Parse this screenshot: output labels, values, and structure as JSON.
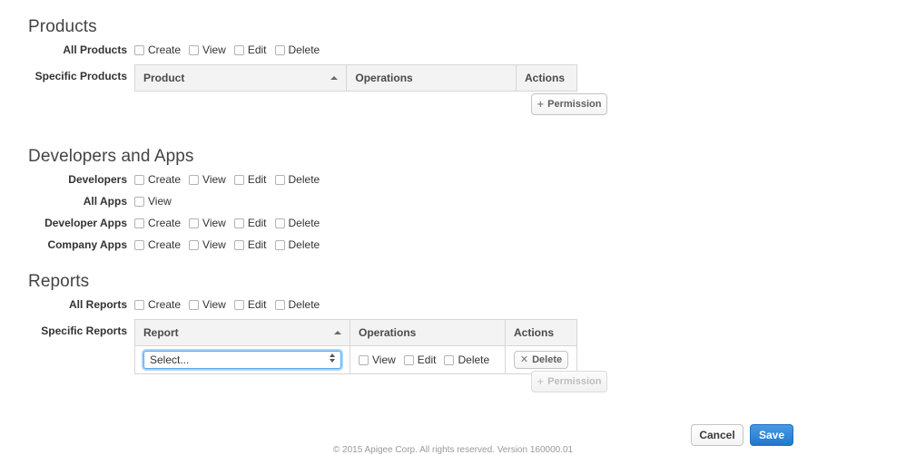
{
  "sections": [
    {
      "id": "products",
      "title": "Products",
      "rows": [
        {
          "label": "All Products",
          "type": "checkboxes",
          "checkboxes": [
            {
              "label": "Create",
              "checked": false
            },
            {
              "label": "View",
              "checked": false
            },
            {
              "label": "Edit",
              "checked": false
            },
            {
              "label": "Delete",
              "checked": false
            }
          ]
        },
        {
          "label": "Specific Products",
          "type": "table",
          "columns": [
            "Product",
            "Operations",
            "Actions"
          ],
          "sorted_column": "Product",
          "sort_direction": "ascending",
          "rows": [],
          "add_button": {
            "label": "Permission",
            "icon": "plus-icon",
            "disabled": false
          }
        }
      ]
    },
    {
      "id": "developers-and-apps",
      "title": "Developers and Apps",
      "rows": [
        {
          "label": "Developers",
          "type": "checkboxes",
          "checkboxes": [
            {
              "label": "Create",
              "checked": false
            },
            {
              "label": "View",
              "checked": false
            },
            {
              "label": "Edit",
              "checked": false
            },
            {
              "label": "Delete",
              "checked": false
            }
          ]
        },
        {
          "label": "All Apps",
          "type": "checkboxes",
          "checkboxes": [
            {
              "label": "View",
              "checked": false
            }
          ]
        },
        {
          "label": "Developer Apps",
          "type": "checkboxes",
          "checkboxes": [
            {
              "label": "Create",
              "checked": false
            },
            {
              "label": "View",
              "checked": false
            },
            {
              "label": "Edit",
              "checked": false
            },
            {
              "label": "Delete",
              "checked": false
            }
          ]
        },
        {
          "label": "Company Apps",
          "type": "checkboxes",
          "checkboxes": [
            {
              "label": "Create",
              "checked": false
            },
            {
              "label": "View",
              "checked": false
            },
            {
              "label": "Edit",
              "checked": false
            },
            {
              "label": "Delete",
              "checked": false
            }
          ]
        }
      ]
    },
    {
      "id": "reports",
      "title": "Reports",
      "rows": [
        {
          "label": "All Reports",
          "type": "checkboxes",
          "checkboxes": [
            {
              "label": "Create",
              "checked": false
            },
            {
              "label": "View",
              "checked": false
            },
            {
              "label": "Edit",
              "checked": false
            },
            {
              "label": "Delete",
              "checked": false
            }
          ]
        },
        {
          "label": "Specific Reports",
          "type": "table",
          "columns": [
            "Report",
            "Operations",
            "Actions"
          ],
          "sorted_column": "Report",
          "sort_direction": "ascending",
          "rows": [
            {
              "select": {
                "value": "Select...",
                "focused": true
              },
              "operations": [
                {
                  "label": "View",
                  "checked": false
                },
                {
                  "label": "Edit",
                  "checked": false
                },
                {
                  "label": "Delete",
                  "checked": false
                }
              ],
              "action": {
                "label": "Delete",
                "icon": "close-x-icon"
              }
            }
          ],
          "add_button": {
            "label": "Permission",
            "icon": "plus-icon",
            "disabled": true
          }
        }
      ]
    }
  ],
  "footer": {
    "cancel_label": "Cancel",
    "save_label": "Save",
    "copyright": "© 2015 Apigee Corp. All rights reserved. Version 160000.01"
  },
  "colors": {
    "save_blue": "#1f78cd",
    "focus_ring": "#65b0f0",
    "table_header_bg": "#f3f3f3",
    "border": "#d6d6d6"
  }
}
